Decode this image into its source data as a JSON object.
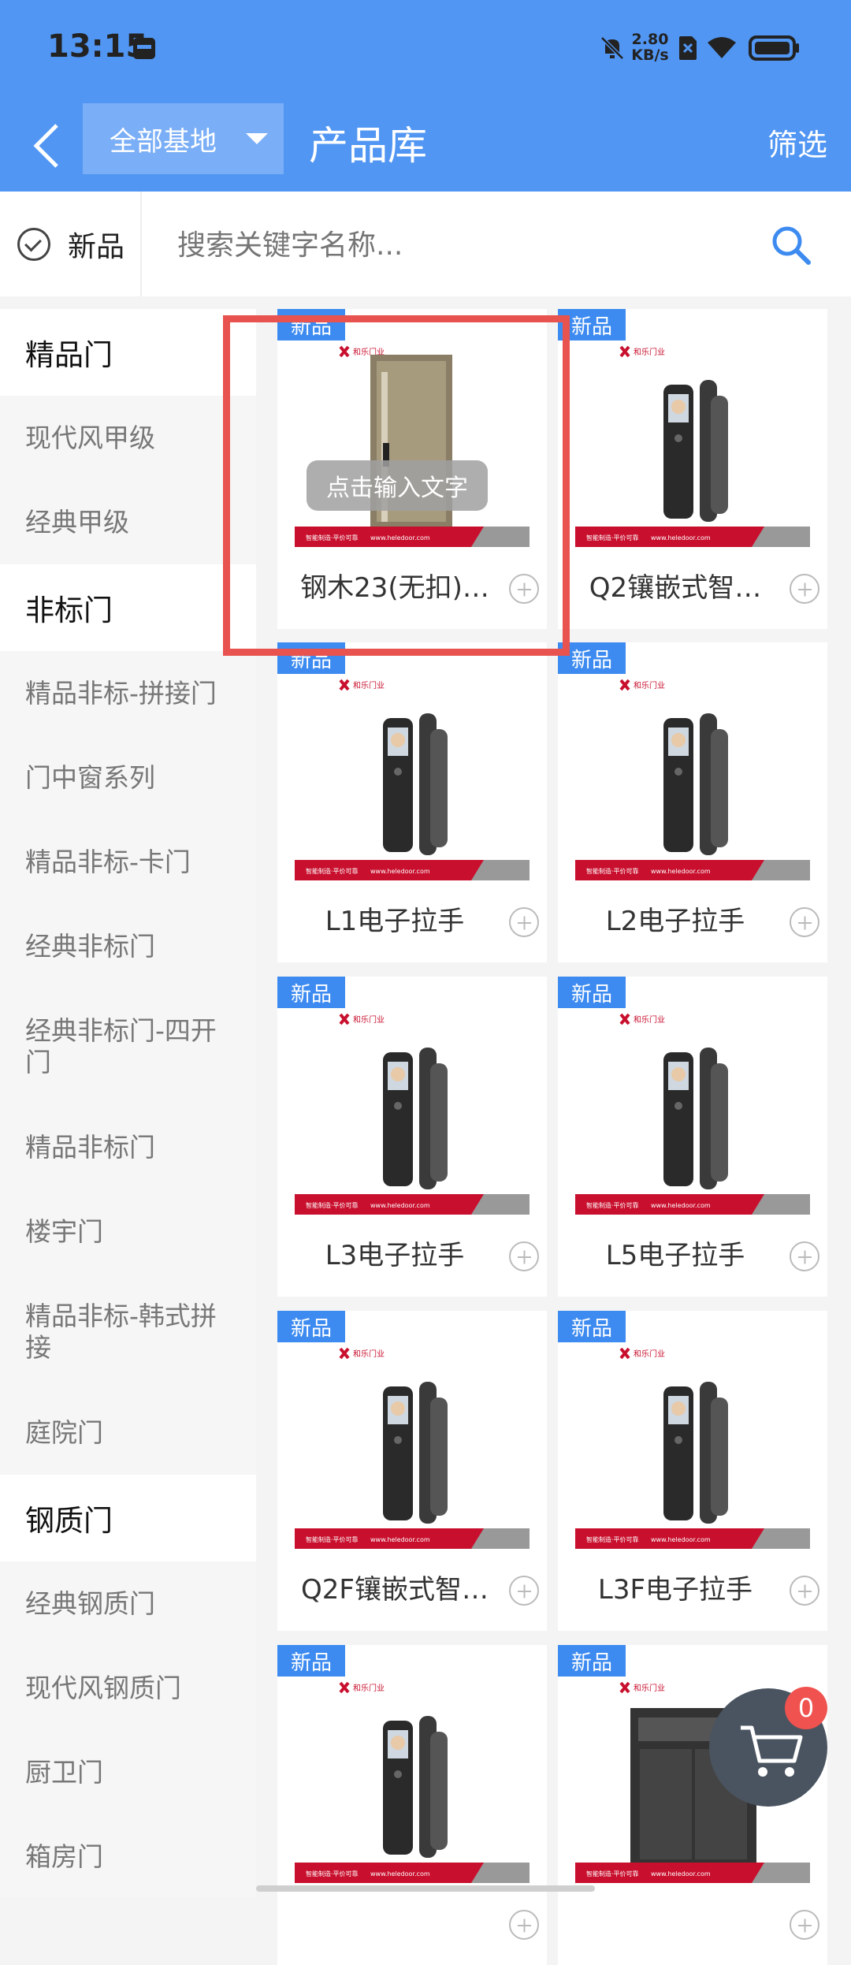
{
  "status": {
    "time": "13:15",
    "net_speed_value": "2.80",
    "net_speed_unit": "KB/s"
  },
  "header": {
    "base_select": "全部基地",
    "title": "产品库",
    "filter": "筛选"
  },
  "search": {
    "new_label": "新品",
    "placeholder": "搜索关键字名称..."
  },
  "sidebar": [
    {
      "label": "精品门",
      "type": "cat"
    },
    {
      "label": "现代风甲级",
      "type": "sub"
    },
    {
      "label": "经典甲级",
      "type": "sub"
    },
    {
      "label": "非标门",
      "type": "cat"
    },
    {
      "label": "精品非标-拼接门",
      "type": "sub"
    },
    {
      "label": "门中窗系列",
      "type": "sub"
    },
    {
      "label": "精品非标-卡门",
      "type": "sub"
    },
    {
      "label": "经典非标门",
      "type": "sub"
    },
    {
      "label": "经典非标门-四开门",
      "type": "tall"
    },
    {
      "label": "精品非标门",
      "type": "sub"
    },
    {
      "label": "楼宇门",
      "type": "sub"
    },
    {
      "label": "精品非标-韩式拼接",
      "type": "tall"
    },
    {
      "label": "庭院门",
      "type": "sub"
    },
    {
      "label": "钢质门",
      "type": "cat"
    },
    {
      "label": "经典钢质门",
      "type": "sub"
    },
    {
      "label": "现代风钢质门",
      "type": "sub"
    },
    {
      "label": "厨卫门",
      "type": "sub"
    },
    {
      "label": "箱房门",
      "type": "sub"
    }
  ],
  "products": [
    {
      "badge": "新品",
      "name": "钢木23(无扣)…",
      "kind": "door"
    },
    {
      "badge": "新品",
      "name": "Q2镶嵌式智…",
      "kind": "lock"
    },
    {
      "badge": "新品",
      "name": "L1电子拉手",
      "kind": "lock"
    },
    {
      "badge": "新品",
      "name": "L2电子拉手",
      "kind": "lock"
    },
    {
      "badge": "新品",
      "name": "L3电子拉手",
      "kind": "lock"
    },
    {
      "badge": "新品",
      "name": "L5电子拉手",
      "kind": "lock"
    },
    {
      "badge": "新品",
      "name": "Q2F镶嵌式智…",
      "kind": "lock"
    },
    {
      "badge": "新品",
      "name": "L3F电子拉手",
      "kind": "lock"
    },
    {
      "badge": "新品",
      "name": "",
      "kind": "lock"
    },
    {
      "badge": "新品",
      "name": "",
      "kind": "door2"
    }
  ],
  "product_image": {
    "brand_text": "和乐门业",
    "banner_left": "智能制造·平价可靠",
    "banner_url": "www.heledoor.com"
  },
  "overlay_tip": "点击输入文字",
  "cart": {
    "count": "0"
  },
  "colors": {
    "primary": "#5196f3",
    "badge": "#3d8bf0",
    "highlight": "#e8524f",
    "banner_red": "#c8102e"
  }
}
